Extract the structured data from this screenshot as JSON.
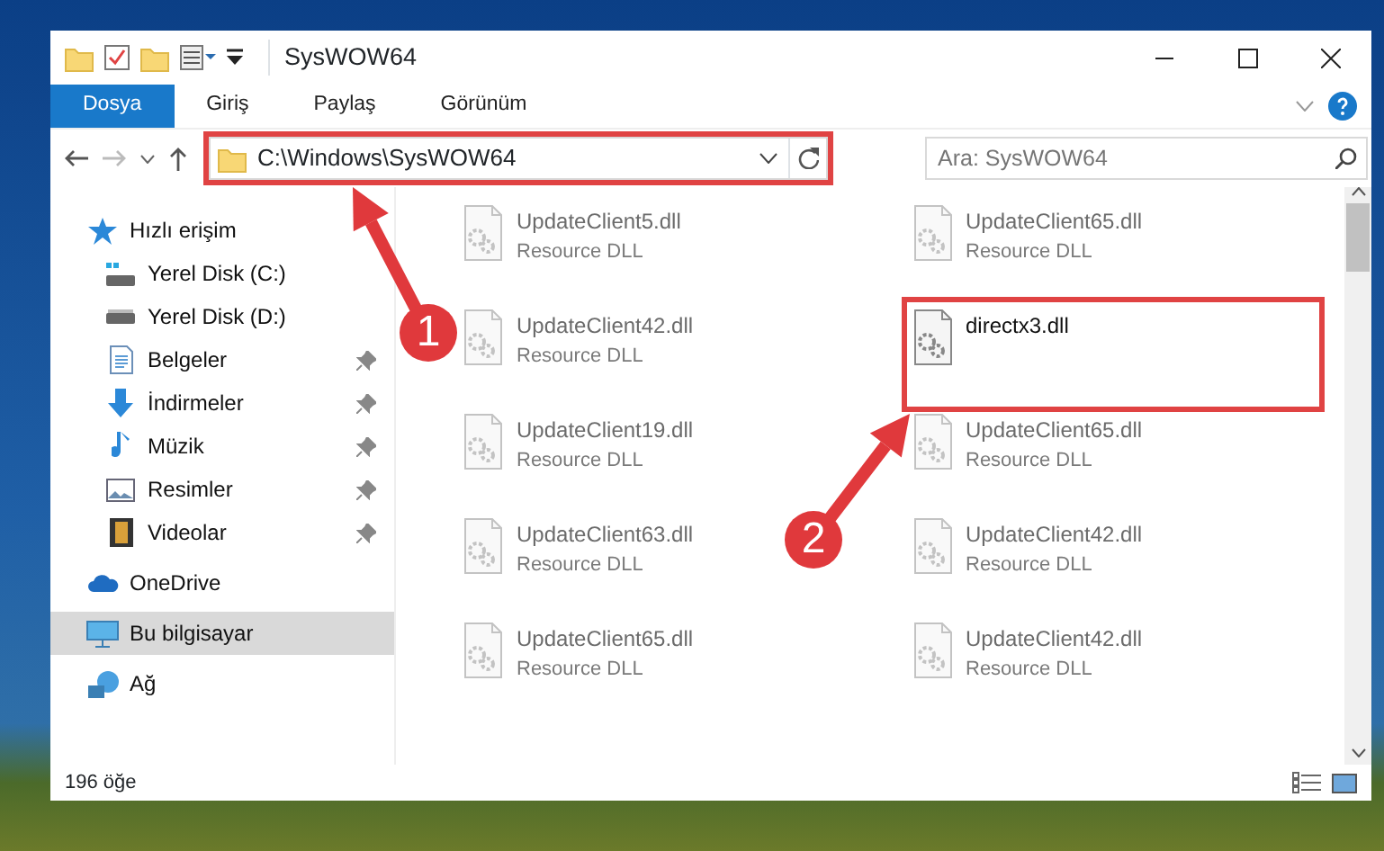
{
  "window": {
    "title": "SysWOW64"
  },
  "ribbon_tabs": [
    {
      "label": "Dosya",
      "selected": true
    },
    {
      "label": "Giriş",
      "selected": false
    },
    {
      "label": "Paylaş",
      "selected": false
    },
    {
      "label": "Görünüm",
      "selected": false
    }
  ],
  "address_bar": {
    "path": "C:\\Windows\\SysWOW64",
    "highlighted": true
  },
  "search": {
    "placeholder": "Ara: SysWOW64"
  },
  "sidebar": {
    "items": [
      {
        "label": "Hızlı erişim",
        "pinned": false,
        "selected": false,
        "children": [
          {
            "label": "Yerel Disk (C:)",
            "pinned": false,
            "selected": false
          },
          {
            "label": "Yerel Disk (D:)",
            "pinned": false,
            "selected": false
          },
          {
            "label": "Belgeler",
            "pinned": true,
            "selected": false
          },
          {
            "label": "İndirmeler",
            "pinned": true,
            "selected": false
          },
          {
            "label": "Müzik",
            "pinned": true,
            "selected": false
          },
          {
            "label": "Resimler",
            "pinned": true,
            "selected": false
          },
          {
            "label": "Videolar",
            "pinned": true,
            "selected": false
          }
        ]
      },
      {
        "label": "OneDrive",
        "pinned": false,
        "selected": false
      },
      {
        "label": "Bu bilgisayar",
        "pinned": false,
        "selected": true
      },
      {
        "label": "Ağ",
        "pinned": false,
        "selected": false
      }
    ]
  },
  "files": [
    {
      "name": "UpdateClient5.dll",
      "type": "Resource DLL",
      "dimmed": true,
      "highlighted": false
    },
    {
      "name": "UpdateClient65.dll",
      "type": "Resource DLL",
      "dimmed": true,
      "highlighted": false
    },
    {
      "name": "UpdateClient42.dll",
      "type": "Resource DLL",
      "dimmed": true,
      "highlighted": false
    },
    {
      "name": "directx3.dll",
      "dimmed": false,
      "highlighted": true
    },
    {
      "name": "UpdateClient19.dll",
      "type": "Resource DLL",
      "dimmed": true,
      "highlighted": false
    },
    {
      "name": "UpdateClient65.dll",
      "type": "Resource DLL",
      "dimmed": true,
      "highlighted": false
    },
    {
      "name": "UpdateClient63.dll",
      "type": "Resource DLL",
      "dimmed": true,
      "highlighted": false
    },
    {
      "name": "UpdateClient42.dll",
      "type": "Resource DLL",
      "dimmed": true,
      "highlighted": false
    },
    {
      "name": "UpdateClient65.dll",
      "type": "Resource DLL",
      "dimmed": true,
      "highlighted": false
    },
    {
      "name": "UpdateClient42.dll",
      "type": "Resource DLL",
      "dimmed": true,
      "highlighted": false
    }
  ],
  "status_bar": {
    "count": "196 öğe"
  },
  "annotations": [
    {
      "number": "1"
    },
    {
      "number": "2"
    }
  ]
}
